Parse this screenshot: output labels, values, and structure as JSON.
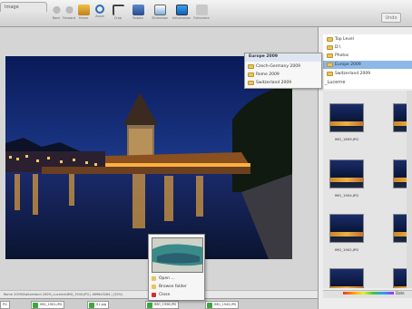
{
  "toolbar": {
    "tab_label": "Image",
    "undo_label": "Undo",
    "buttons": [
      {
        "label": "Back",
        "icon": "back-arrow-icon"
      },
      {
        "label": "Forward",
        "icon": "forward-arrow-icon"
      },
      {
        "label": "Home",
        "icon": "home-icon"
      },
      {
        "label": "Zoom",
        "icon": "zoom-icon"
      },
      {
        "label": "Crop",
        "icon": "crop-icon"
      },
      {
        "label": "Rotate",
        "icon": "rotate-icon"
      },
      {
        "label": "Slideshow",
        "icon": "slideshow-icon"
      },
      {
        "label": "Information",
        "icon": "information-icon"
      },
      {
        "label": "Fullscreen",
        "icon": "fullscreen-icon"
      }
    ]
  },
  "status_bar": {
    "text": "Rome 2009\\Switzerland 2009\\_Lucerne\\IMG_1940.JPG  |  4896x3264  |  (32%)"
  },
  "filmstrip": {
    "tabs": [
      {
        "label": "PG"
      },
      {
        "label": "IMG_1902.JPG"
      },
      {
        "label": "IMG_1936.JPG"
      },
      {
        "label": "01.jpg"
      },
      {
        "label": "IMG_1940.JPG"
      }
    ]
  },
  "dropdown": {
    "header": "Europe 2009",
    "items": [
      "Czech-Germany 2009",
      "Rome 2009",
      "Switzerland 2009"
    ]
  },
  "folder_tree": {
    "items": [
      {
        "label": "Top Level",
        "selected": false
      },
      {
        "label": "D:\\",
        "selected": false
      },
      {
        "label": "Photos",
        "selected": false
      },
      {
        "label": "Europe 2009",
        "selected": true
      },
      {
        "label": "Switzerland 2009",
        "selected": false
      }
    ],
    "current_folder": "_Lucerne"
  },
  "thumbnails": [
    {
      "caption": "IMG_1899.JPG"
    },
    {
      "caption": "IMG_1904.JPG"
    },
    {
      "caption": "IMG_1902.JPG"
    },
    {
      "caption": ""
    }
  ],
  "right_bottom": {
    "date_label": "Date"
  },
  "context_menu": {
    "items": [
      {
        "label": "Open ...",
        "icon": "open-icon"
      },
      {
        "label": "Browse folder",
        "icon": "folder-icon"
      },
      {
        "label": "Close",
        "icon": "close-icon"
      }
    ]
  },
  "colors": {
    "selection": "#8cb8e8",
    "folder": "#e7c55a",
    "accent": "#3aa83a"
  }
}
